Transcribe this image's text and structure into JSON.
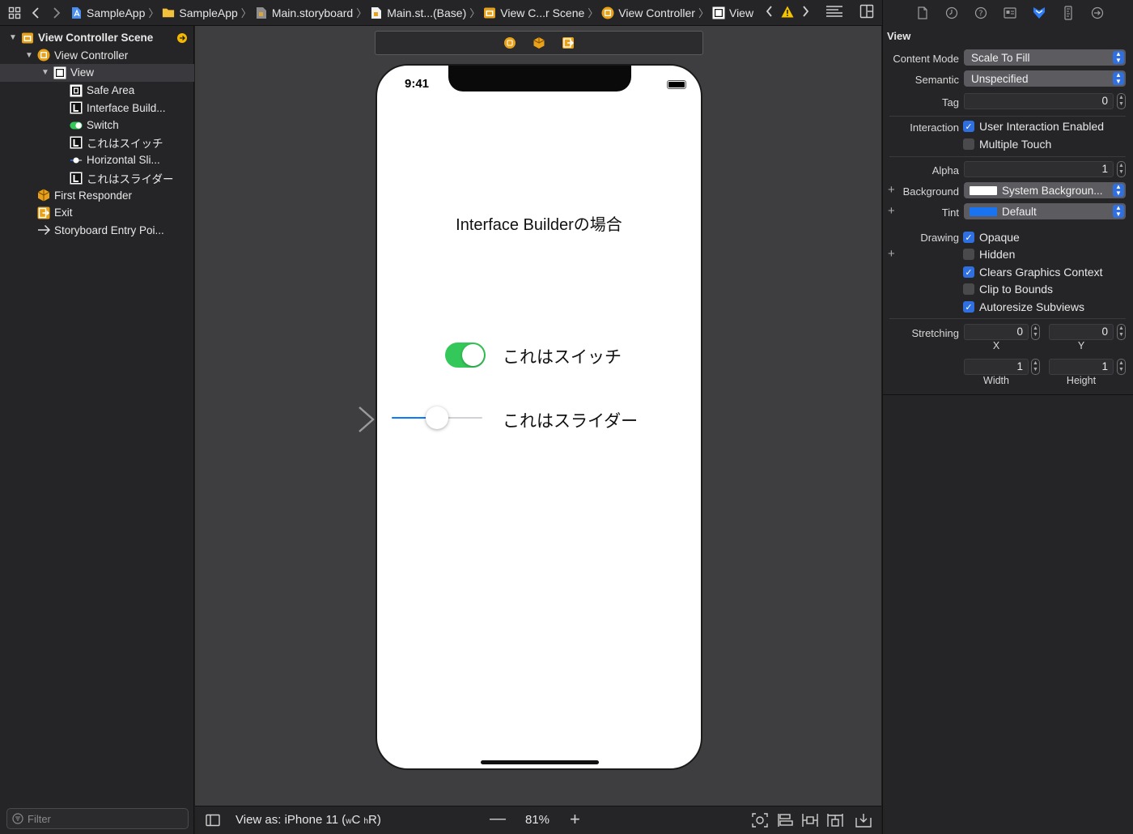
{
  "breadcrumbs": [
    {
      "label": "SampleApp",
      "icon": "project-icon"
    },
    {
      "label": "SampleApp",
      "icon": "folder-icon"
    },
    {
      "label": "Main.storyboard",
      "icon": "storyboard-icon"
    },
    {
      "label": "Main.st...(Base)",
      "icon": "storyboard-file-icon"
    },
    {
      "label": "View C...r Scene",
      "icon": "scene-icon"
    },
    {
      "label": "View Controller",
      "icon": "view-controller-icon"
    },
    {
      "label": "View",
      "icon": "view-icon"
    }
  ],
  "navigator": {
    "items": [
      {
        "label": "View Controller Scene",
        "level": 0,
        "icon": "scene-icon",
        "bold": true
      },
      {
        "label": "View Controller",
        "level": 1,
        "icon": "view-controller-icon"
      },
      {
        "label": "View",
        "level": 2,
        "icon": "view-icon",
        "selected": true
      },
      {
        "label": "Safe Area",
        "level": 3,
        "icon": "safe-area-icon"
      },
      {
        "label": "Interface Build...",
        "level": 3,
        "icon": "label-icon"
      },
      {
        "label": "Switch",
        "level": 3,
        "icon": "switch-icon"
      },
      {
        "label": "これはスイッチ",
        "level": 3,
        "icon": "label-icon"
      },
      {
        "label": "Horizontal Sli...",
        "level": 3,
        "icon": "slider-icon"
      },
      {
        "label": "これはスライダー",
        "level": 3,
        "icon": "label-icon"
      },
      {
        "label": "First Responder",
        "level": 1,
        "icon": "first-responder-icon"
      },
      {
        "label": "Exit",
        "level": 1,
        "icon": "exit-icon"
      },
      {
        "label": "Storyboard Entry Poi...",
        "level": 1,
        "icon": "entry-arrow-icon"
      }
    ],
    "filter_placeholder": "Filter"
  },
  "phone": {
    "time": "9:41",
    "title": "Interface Builderの場合",
    "switch_label": "これはスイッチ",
    "switch_on": true,
    "slider_label": "これはスライダー",
    "slider_value": 0.5
  },
  "bottom": {
    "view_as_prefix": "View as: iPhone 11 (",
    "w": "w",
    "wc": "C",
    "h": "h",
    "hr": "R)",
    "zoom": "81%"
  },
  "inspector": {
    "section": "View",
    "content_mode_label": "Content Mode",
    "content_mode_value": "Scale To Fill",
    "semantic_label": "Semantic",
    "semantic_value": "Unspecified",
    "tag_label": "Tag",
    "tag_value": "0",
    "interaction_label": "Interaction",
    "user_interaction": "User Interaction Enabled",
    "multiple_touch": "Multiple Touch",
    "alpha_label": "Alpha",
    "alpha_value": "1",
    "background_label": "Background",
    "background_value": "System Backgroun...",
    "tint_label": "Tint",
    "tint_value": "Default",
    "drawing_label": "Drawing",
    "opaque": "Opaque",
    "hidden": "Hidden",
    "clears_graphics": "Clears Graphics Context",
    "clip_bounds": "Clip to Bounds",
    "autoresize": "Autoresize Subviews",
    "stretching_label": "Stretching",
    "stretch_x": "0",
    "stretch_y": "0",
    "x_label": "X",
    "y_label": "Y",
    "stretch_w": "1",
    "stretch_h": "1",
    "width_label": "Width",
    "height_label": "Height"
  },
  "colors": {
    "accent": "#2f6fe0",
    "switch_green": "#34c759",
    "slider_blue": "#0a7aff",
    "warning": "#f5c400",
    "orange": "#e8a21a"
  }
}
